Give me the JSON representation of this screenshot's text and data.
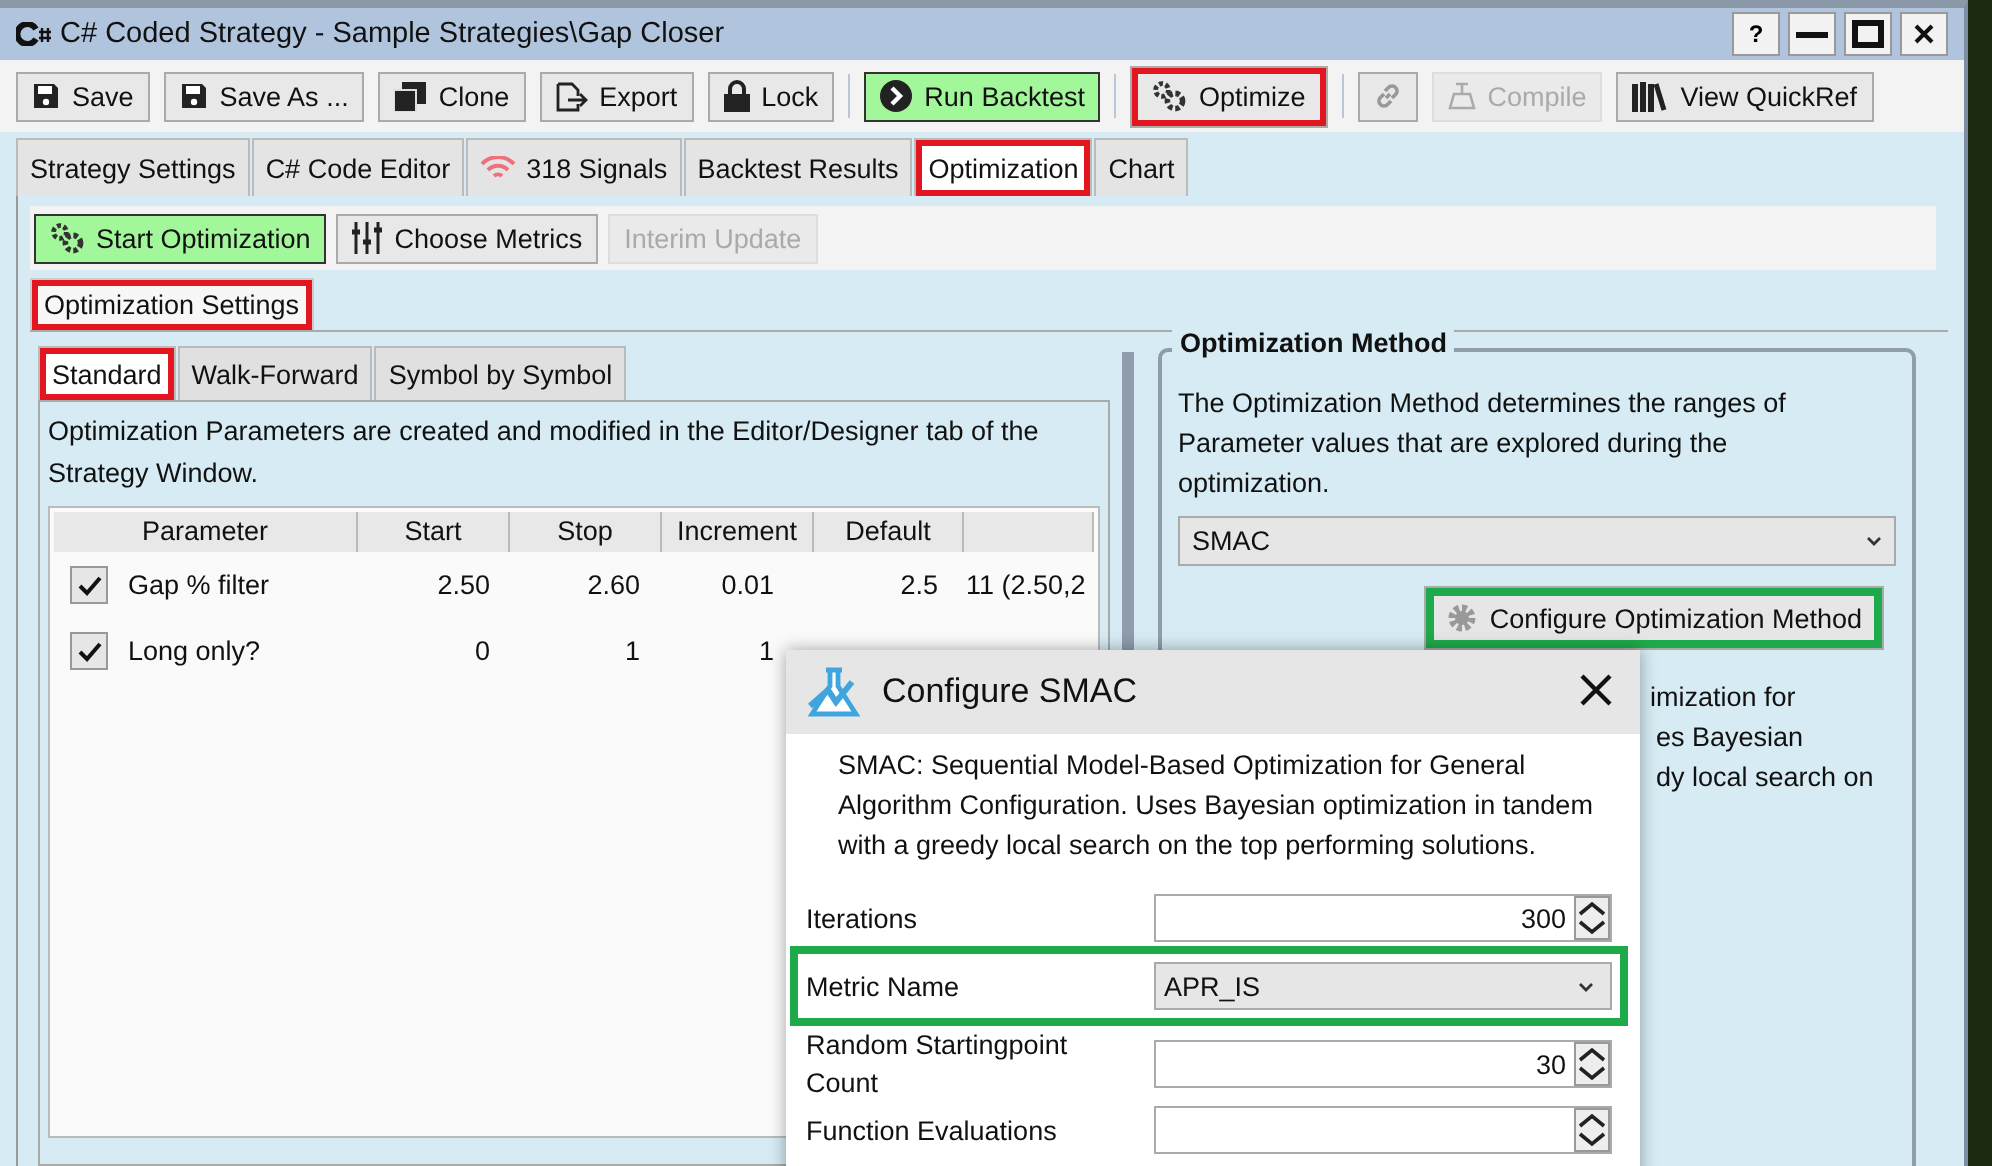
{
  "window": {
    "title": "C# Coded Strategy - Sample Strategies\\Gap Closer",
    "controls": [
      "?"
    ]
  },
  "toolbar": [
    {
      "label": "Save",
      "kind": "normal",
      "highlighted": false
    },
    {
      "label": "Save As ...",
      "kind": "normal",
      "highlighted": false
    },
    {
      "label": "Clone",
      "kind": "normal",
      "highlighted": false
    },
    {
      "label": "Export",
      "kind": "normal",
      "highlighted": false
    },
    {
      "label": "Lock",
      "kind": "normal",
      "highlighted": false
    },
    {
      "label": "Run Backtest",
      "kind": "primary",
      "highlighted": false
    },
    {
      "label": "Optimize",
      "kind": "normal",
      "highlighted": true
    },
    {
      "kind": "normal",
      "highlighted": false
    },
    {
      "label": "Compile",
      "kind": "disabled",
      "highlighted": false
    },
    {
      "label": "View QuickRef",
      "kind": "normal",
      "highlighted": false
    }
  ],
  "tabs": [
    {
      "label": "Strategy Settings",
      "selected": false,
      "highlighted": false
    },
    {
      "label": "C# Code Editor",
      "selected": false,
      "highlighted": false
    },
    {
      "label": "318 Signals",
      "selected": false,
      "highlighted": false
    },
    {
      "label": "Backtest Results",
      "selected": false,
      "highlighted": false
    },
    {
      "label": "Optimization",
      "selected": true,
      "highlighted": true
    },
    {
      "label": "Chart",
      "selected": false,
      "highlighted": false
    }
  ],
  "sub_toolbar": [
    {
      "label": "Start Optimization",
      "kind": "primary"
    },
    {
      "label": "Choose Metrics",
      "kind": "normal"
    },
    {
      "label": "Interim Update",
      "kind": "disabled"
    }
  ],
  "settings_tab": {
    "label": "Optimization Settings",
    "highlighted": true
  },
  "mode_tabs": [
    {
      "label": "Standard",
      "selected": true,
      "highlighted": true
    },
    {
      "label": "Walk-Forward",
      "selected": false,
      "highlighted": false
    },
    {
      "label": "Symbol by Symbol",
      "selected": false,
      "highlighted": false
    }
  ],
  "description": "Optimization Parameters are created and modified in the Editor/Designer tab of the Strategy Window.",
  "table": {
    "columns": [
      "Parameter",
      "Start",
      "Stop",
      "Increment",
      "Default"
    ],
    "rows": [
      {
        "checked": true,
        "cells": [
          "Gap % filter",
          "2.50",
          "2.60",
          "0.01",
          "2.5",
          "11 (2.50,2"
        ]
      },
      {
        "checked": true,
        "cells": [
          "Long only?",
          "0",
          "1",
          "1"
        ]
      }
    ]
  },
  "method": {
    "title": "Optimization Method",
    "description": "The Optimization Method determines the ranges of Parameter values that are explored during the optimization.",
    "value": "SMAC",
    "configure_button": "Configure Optimization Method",
    "configure_highlighted": true,
    "covered_text_lines": [
      "imization for",
      "es Bayesian",
      "dy local search on"
    ]
  },
  "dialog": {
    "title": "Configure SMAC",
    "description": "SMAC: Sequential Model-Based Optimization for General Algorithm Configuration. Uses Bayesian optimization in tandem with a greedy local search on the top performing solutions.",
    "fields": [
      {
        "label": "Iterations",
        "kind": "spinner",
        "value": "300",
        "highlighted": false
      },
      {
        "label": "Metric Name",
        "kind": "dropdown",
        "value": "APR_IS",
        "highlighted": true
      },
      {
        "label": "Random Startingpoint Count",
        "kind": "spinner",
        "value": "30",
        "highlighted": false
      },
      {
        "label": "Function Evaluations",
        "kind": "spinner",
        "highlighted": false
      }
    ]
  }
}
